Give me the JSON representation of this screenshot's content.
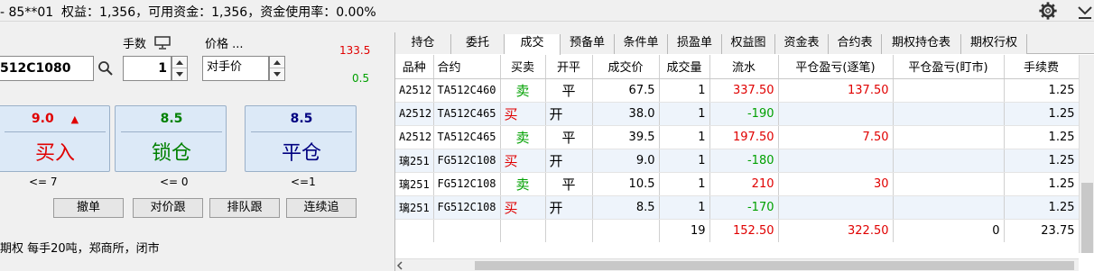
{
  "topbar": {
    "status": "- 85**01  权益：1,356，可用资金：1,356，资金使用率：0.00%"
  },
  "order": {
    "qty_label": "手数",
    "price_label": "价格 ...",
    "upper_limit": "133.5",
    "lower_limit": "0.5",
    "contract": "512C1080",
    "quantity": "1",
    "price_type": "对手价",
    "buttons": [
      {
        "price": "9.0",
        "label": "买入",
        "limit": "<= 7"
      },
      {
        "price": "8.5",
        "label": "锁仓",
        "limit": "<= 0"
      },
      {
        "price": "8.5",
        "label": "平仓",
        "limit": "<=1"
      }
    ],
    "actions": [
      "撤单",
      "对价跟",
      "排队跟",
      "连续追"
    ],
    "info": "期权 每手20吨，郑商所，闭市"
  },
  "tabs": [
    "持仓",
    "委托",
    "成交",
    "预备单",
    "条件单",
    "损盈单",
    "权益图",
    "资金表",
    "合约表",
    "期权持仓表",
    "期权行权"
  ],
  "active_tab": "成交",
  "table": {
    "headers": [
      "品种",
      "合约",
      "买卖",
      "开平",
      "成交价",
      "成交量",
      "流水",
      "平仓盈亏(逐笔)",
      "平仓盈亏(盯市)",
      "手续费"
    ],
    "rows": [
      [
        "A2512",
        "TA512C460",
        "卖",
        "平",
        "67.5",
        "1",
        "337.50",
        "137.50",
        "",
        "1.25"
      ],
      [
        "A2512",
        "TA512C465",
        "买",
        "开",
        "38.0",
        "1",
        "-190",
        "",
        "",
        "1.25"
      ],
      [
        "A2512",
        "TA512C465",
        "卖",
        "平",
        "39.5",
        "1",
        "197.50",
        "7.50",
        "",
        "1.25"
      ],
      [
        "璃251",
        "FG512C108",
        "买",
        "开",
        "9.0",
        "1",
        "-180",
        "",
        "",
        "1.25"
      ],
      [
        "璃251",
        "FG512C108",
        "卖",
        "平",
        "10.5",
        "1",
        "210",
        "30",
        "",
        "1.25"
      ],
      [
        "璃251",
        "FG512C108",
        "买",
        "开",
        "8.5",
        "1",
        "-170",
        "",
        "",
        "1.25"
      ]
    ],
    "totals": [
      "",
      "",
      "",
      "",
      "",
      "19",
      "152.50",
      "322.50",
      "0",
      "23.75"
    ]
  },
  "colors": {
    "buy": "#e00000",
    "sell": "#00a000",
    "close": "#000080"
  }
}
